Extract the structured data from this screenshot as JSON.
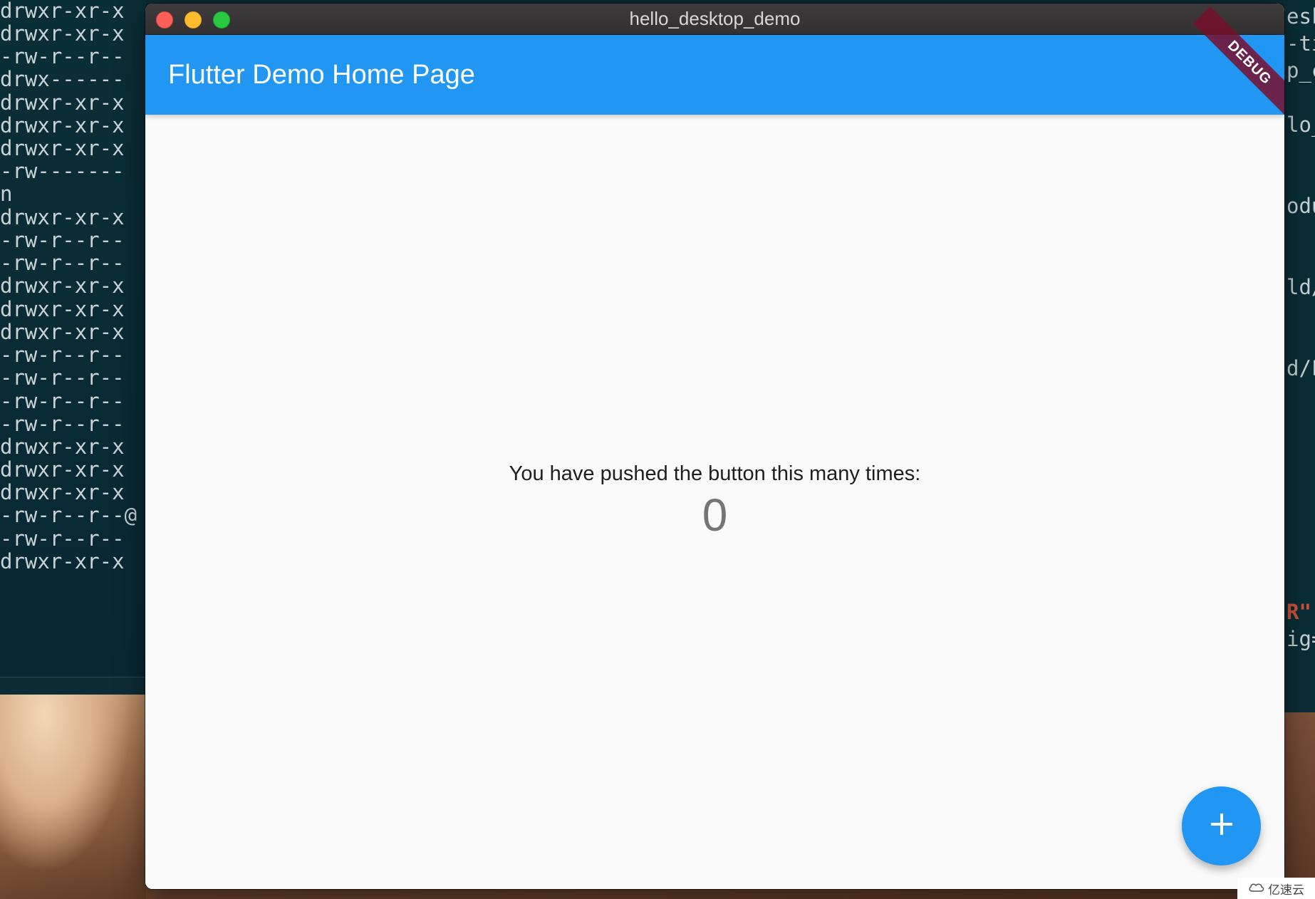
{
  "terminal_left": {
    "lines": [
      "drwxr-xr-x",
      "drwxr-xr-x",
      "-rw-r--r--",
      "drwx------",
      "drwxr-xr-x",
      "drwxr-xr-x",
      "drwxr-xr-x",
      "-rw-------",
      "n",
      "drwxr-xr-x",
      "-rw-r--r--",
      "-rw-r--r--",
      "drwxr-xr-x",
      "drwxr-xr-x",
      "drwxr-xr-x",
      "-rw-r--r--",
      "-rw-r--r--",
      "-rw-r--r--",
      "-rw-r--r--",
      "drwxr-xr-x",
      "drwxr-xr-x",
      "drwxr-xr-x",
      "-rw-r--r--@",
      "-rw-r--r--",
      "drwxr-xr-x"
    ]
  },
  "terminal_right": {
    "lines": [
      "esk",
      "-ti",
      "p_c",
      "",
      "lo_",
      "",
      "",
      "odu",
      "",
      "",
      "ld/",
      "",
      "",
      "d/F",
      "",
      "",
      "",
      "",
      "",
      "",
      "",
      "",
      "R\"",
      "ig="
    ]
  },
  "window": {
    "title": "hello_desktop_demo",
    "controls": {
      "close": "close",
      "minimize": "minimize",
      "zoom": "zoom"
    }
  },
  "app": {
    "appbar_title": "Flutter Demo Home Page",
    "debug_banner": "DEBUG",
    "counter_label": "You have pushed the button this many times:",
    "counter_value": "0",
    "fab_icon": "plus-icon"
  },
  "watermark": {
    "text": "亿速云"
  },
  "colors": {
    "primary": "#2196f3",
    "background": "#fafafa",
    "debug_banner": "#780f2d",
    "titlebar": "#3a3839"
  }
}
